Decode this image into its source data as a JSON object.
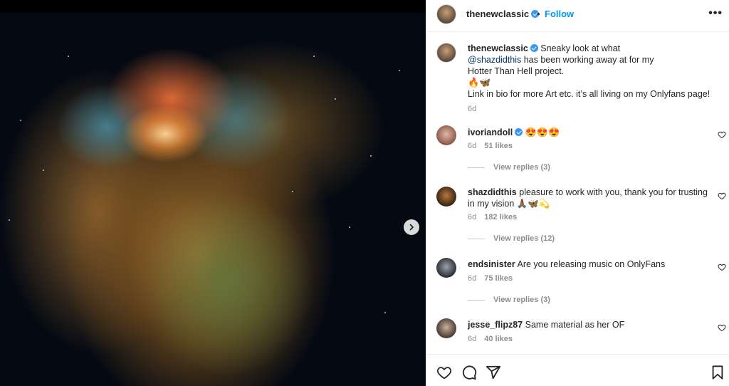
{
  "post": {
    "username": "thenewclassic",
    "dot": "•",
    "follow_label": "Follow",
    "more_label": "•••"
  },
  "caption": {
    "username": "thenewclassic",
    "text_1": "Sneaky look at what",
    "mention": "@shazdidthis",
    "text_2": "has been working away at for my",
    "text_3": "Hotter Than Hell project.",
    "emojis": "🔥🦋",
    "text_4": "Link in bio for more Art etc. it’s all living on my Onlyfans page!",
    "time": "6d"
  },
  "comments": [
    {
      "username": "ivoriandoll",
      "verified": true,
      "text": "😍😍😍",
      "time": "6d",
      "likes": "51 likes",
      "view_replies": "View replies (3)"
    },
    {
      "username": "shazdidthis",
      "verified": false,
      "text": "pleasure to work with you, thank you for trusting in my vision 🙏🏾🦋💫",
      "time": "6d",
      "likes": "182 likes",
      "view_replies": "View replies (12)"
    },
    {
      "username": "endsinister",
      "verified": false,
      "text": "Are you releasing music on OnlyFans",
      "time": "6d",
      "likes": "75 likes",
      "view_replies": "View replies (3)"
    },
    {
      "username": "jesse_flipz87",
      "verified": false,
      "text": "Same material as her OF",
      "time": "6d",
      "likes": "40 likes"
    }
  ],
  "icons": {
    "like": "heart-icon",
    "comment": "comment-icon",
    "share": "share-icon",
    "save": "bookmark-icon",
    "next": "chevron-right-icon"
  },
  "colors": {
    "accent": "#0095f6",
    "verified": "#3897f0",
    "muted": "#8e8e8e"
  }
}
